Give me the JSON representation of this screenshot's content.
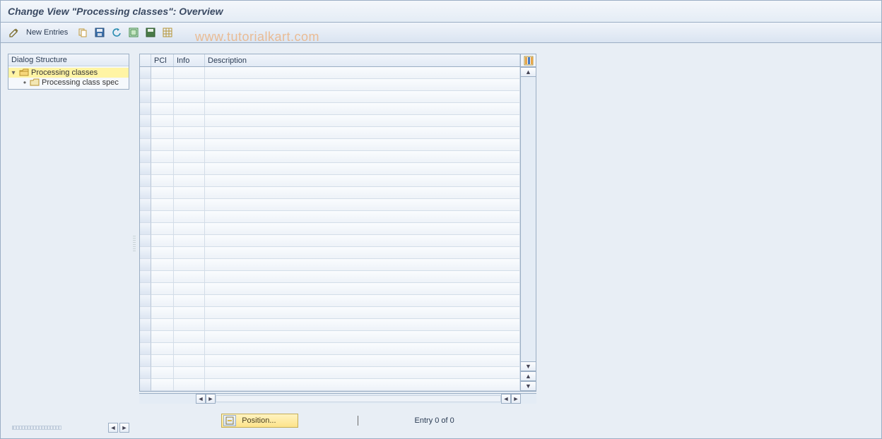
{
  "title": "Change View \"Processing classes\": Overview",
  "toolbar": {
    "new_entries_label": "New Entries"
  },
  "watermark": "www.tutorialkart.com",
  "sidebar": {
    "header": "Dialog Structure",
    "items": [
      {
        "label": "Processing classes",
        "selected": true,
        "open": true,
        "level": 0
      },
      {
        "label": "Processing class spec",
        "selected": false,
        "open": false,
        "level": 1
      }
    ]
  },
  "grid": {
    "columns": {
      "pcl": "PCl",
      "info": "Info",
      "desc": "Description"
    },
    "rows": []
  },
  "footer": {
    "position_label": "Position...",
    "entry_text": "Entry 0 of 0"
  }
}
